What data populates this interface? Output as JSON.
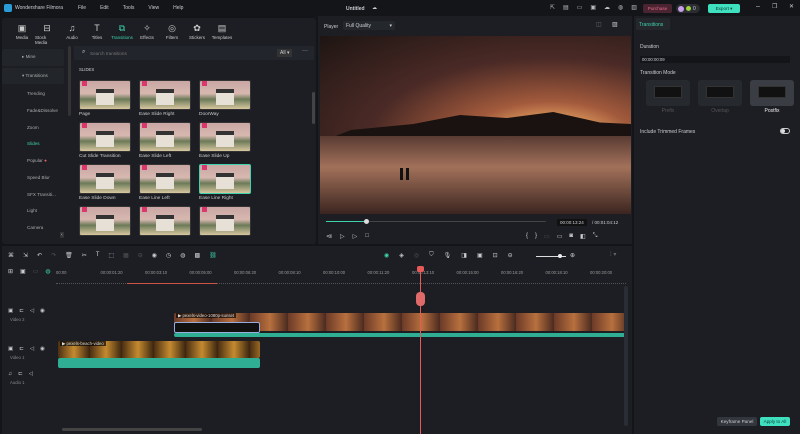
{
  "app": {
    "name": "Wondershare Filmora",
    "project": "Untitled",
    "menu": [
      "File",
      "Edit",
      "Tools",
      "View",
      "Help"
    ],
    "purchase": "Purchase",
    "credits": "0",
    "export": "Export"
  },
  "toolbar": [
    "Media",
    "Stock Media",
    "Audio",
    "Titles",
    "Transitions",
    "Effects",
    "Filters",
    "Stickers",
    "Templates"
  ],
  "toolbar_icons": [
    "▣",
    "⊟",
    "♫",
    "T",
    "⧉",
    "✧",
    "◎",
    "✿",
    "▤"
  ],
  "categories": {
    "mine": "Mine",
    "transitions": "Transitions",
    "items": [
      "Trending",
      "Fade&Dissolve",
      "Zoom",
      "Slides",
      "Popular",
      "Speed Blur",
      "SFX Transiti...",
      "Light",
      "Camera"
    ]
  },
  "search": {
    "placeholder": "Search transitions",
    "filter": "All"
  },
  "section": "SLIDES",
  "transitions": [
    "Page",
    "Ease Slide Right",
    "DoorWay",
    "Cut Slide Transition",
    "Ease Slide Left",
    "Ease Slide Up",
    "Ease Slide Down",
    "Ease Line Left",
    "Ease Line Right",
    "",
    "",
    ""
  ],
  "player": {
    "label": "Player",
    "quality": "Full Quality",
    "current": "00:00:13:24",
    "total": "00:01:04:12",
    "progress": 0.18
  },
  "props": {
    "tab": "Transitions",
    "duration_label": "Duration",
    "duration": "00:00:00:09",
    "mode_label": "Transition Mode",
    "modes": [
      "Prefix",
      "Overlap",
      "Postfix"
    ],
    "trimmed": "Include Trimmed Frames",
    "keyframe": "Keyframe Panel",
    "apply": "Apply to All"
  },
  "ruler": [
    "00:00",
    "00:00:01:20",
    "00:00:03:10",
    "00:00:05:00",
    "00:00:06:20",
    "00:00:08:10",
    "00:00:10:00",
    "00:00:11:20",
    "00:00:13:10",
    "00:00:15:00",
    "00:00:16:20",
    "00:00:18:10",
    "00:00:20:00"
  ],
  "tracks": [
    "Video 2",
    "Video 1",
    "Audio 1"
  ],
  "clips": {
    "v2": "pexels-video-1080p-sunset",
    "v1": "pexels-beach-video"
  }
}
